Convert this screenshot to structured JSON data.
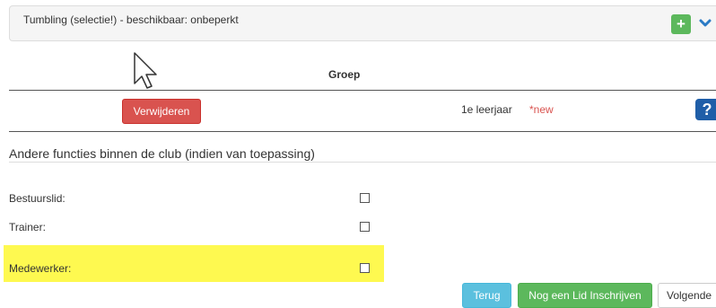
{
  "panel": {
    "title": "Tumbling (selectie!) - beschikbaar: onbeperkt",
    "add_symbol": "+"
  },
  "table": {
    "column_header": "Groep",
    "row": {
      "delete_label": "Verwijderen",
      "grade": "1e leerjaar",
      "new_tag": "*new",
      "help_symbol": "?"
    }
  },
  "functions": {
    "title": "Andere functies binnen de club (indien van toepassing)",
    "fields": [
      {
        "label": "Bestuurslid:",
        "checked": false
      },
      {
        "label": "Trainer:",
        "checked": false
      },
      {
        "label": "Medewerker:",
        "checked": false,
        "highlighted": true
      }
    ]
  },
  "footer": {
    "back_label": "Terug",
    "register_another_label": "Nog een Lid Inschrijven",
    "next_label": "Volgende"
  },
  "colors": {
    "success": "#5cb85c",
    "danger": "#d9534f",
    "info": "#5bc0de",
    "highlight": "#fef950",
    "help": "#1f5ea8",
    "chevron": "#2a7ac5"
  },
  "icons": [
    "plus-icon",
    "chevron-down-icon",
    "mouse-cursor-icon",
    "help-icon"
  ]
}
